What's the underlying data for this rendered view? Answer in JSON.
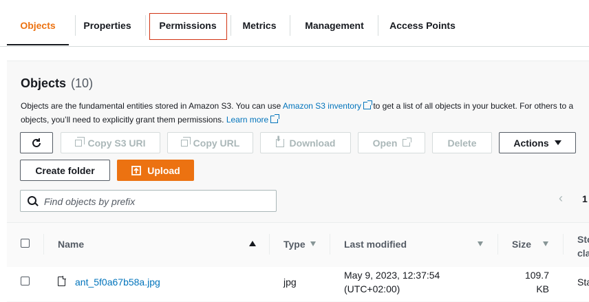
{
  "tabs": [
    {
      "label": "Objects",
      "active": true
    },
    {
      "label": "Properties"
    },
    {
      "label": "Permissions",
      "highlighted": true
    },
    {
      "label": "Metrics"
    },
    {
      "label": "Management"
    },
    {
      "label": "Access Points"
    }
  ],
  "objects": {
    "title": "Objects",
    "count": "(10)",
    "description_1": "Objects are the fundamental entities stored in Amazon S3. You can use",
    "inventory_link": "Amazon S3 inventory",
    "description_2": "to get a list of all objects in your bucket. For others to a",
    "description_3": "objects, you’ll need to explicitly grant them permissions.",
    "learn_more": "Learn more"
  },
  "toolbar": {
    "refresh_icon": "refresh-icon",
    "copy_s3_uri": "Copy S3 URI",
    "copy_url": "Copy URL",
    "download": "Download",
    "open": "Open",
    "delete": "Delete",
    "actions": "Actions",
    "create_folder": "Create folder",
    "upload": "Upload"
  },
  "search": {
    "placeholder": "Find objects by prefix",
    "value": ""
  },
  "pagination": {
    "current_page": "1"
  },
  "table": {
    "columns": [
      "Name",
      "Type",
      "Last modified",
      "Size",
      "Sto cla"
    ],
    "column_storage_1": "Sto",
    "column_storage_2": "cla",
    "rows": [
      {
        "name": "ant_5f0a67b58a.jpg",
        "type": "jpg",
        "last_modified_1": "May 9, 2023, 12:37:54",
        "last_modified_2": "(UTC+02:00)",
        "size_1": "109.7",
        "size_2": "KB",
        "storage_class": "Sta"
      }
    ]
  },
  "colors": {
    "accent": "#ec7211",
    "link": "#0073bb",
    "highlight_box": "#d13212"
  }
}
